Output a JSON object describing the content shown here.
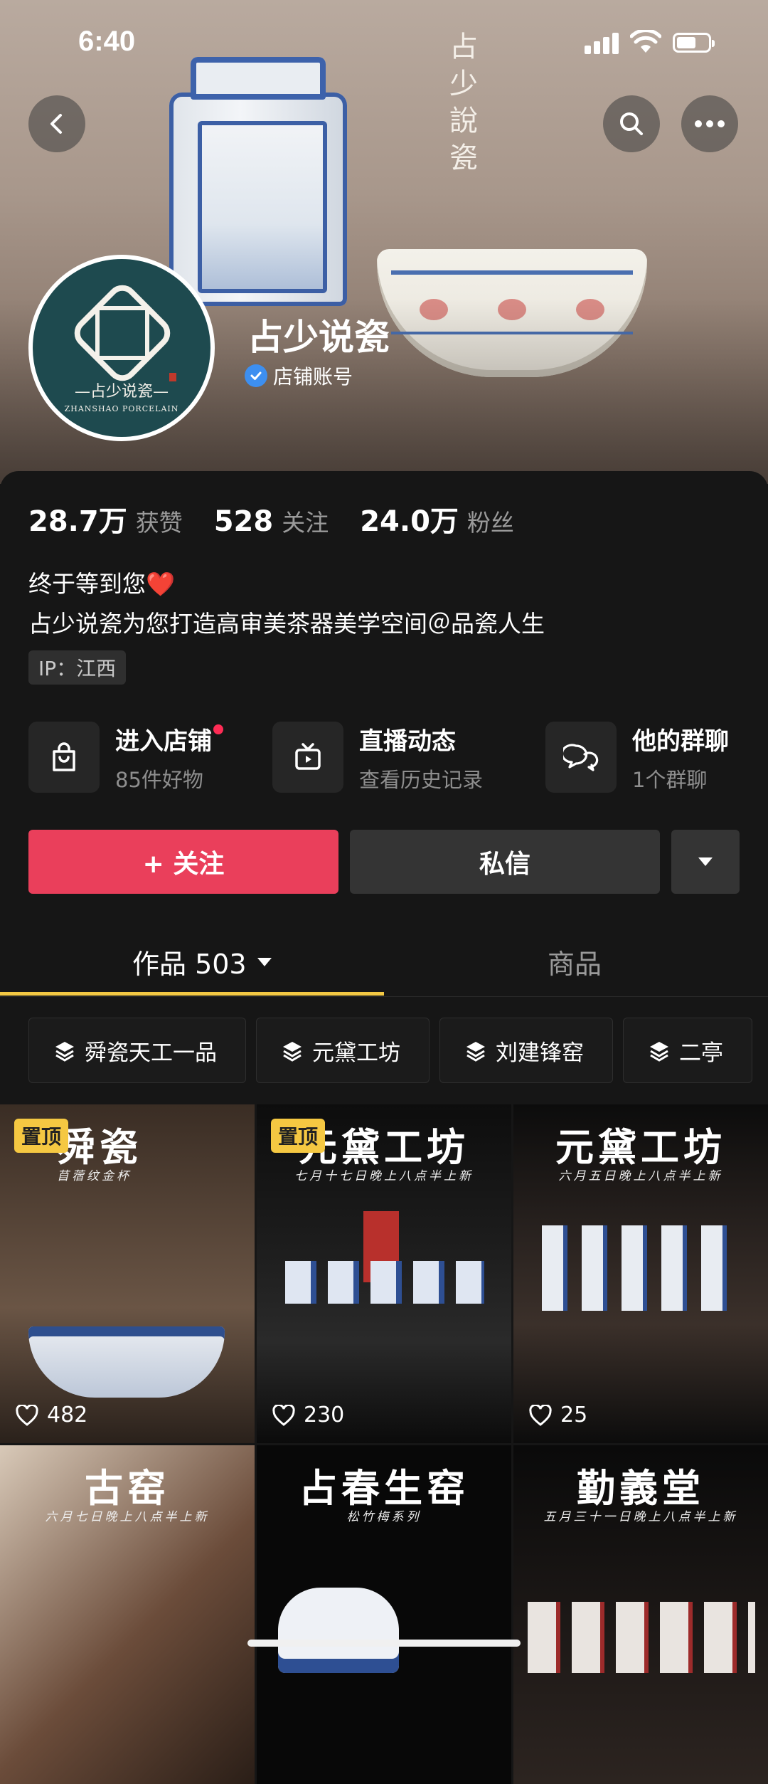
{
  "status_bar": {
    "time": "6:40"
  },
  "header": {
    "cover_vertical_text": "占少說瓷",
    "back_icon": "chevron-left-icon",
    "search_icon": "search-icon",
    "more_icon": "more-dots-icon"
  },
  "profile": {
    "avatar_text_cn": "—占少说瓷—",
    "avatar_text_en": "ZHANSHAO PORCELAIN",
    "name": "占少说瓷",
    "account_type": "店铺账号",
    "verified_color": "#3d8ff0"
  },
  "stats": [
    {
      "value": "28.7万",
      "label": "获赞"
    },
    {
      "value": "528",
      "label": "关注"
    },
    {
      "value": "24.0万",
      "label": "粉丝"
    }
  ],
  "bio": {
    "line1": "终于等到您",
    "line1_emoji": "❤️",
    "line2": "占少说瓷为您打造高审美茶器美学空间＠品瓷人生",
    "ip": "IP：江西"
  },
  "entries": [
    {
      "title": "进入店铺",
      "subtitle": "85件好物",
      "icon": "shopping-bag-icon",
      "has_dot": true
    },
    {
      "title": "直播动态",
      "subtitle": "查看历史记录",
      "icon": "tv-icon",
      "has_dot": false
    },
    {
      "title": "他的群聊",
      "subtitle": "1个群聊",
      "icon": "chat-bubbles-icon",
      "has_dot": false
    }
  ],
  "actions": {
    "follow": "+ 关注",
    "message": "私信",
    "follow_color": "#ea3f5b"
  },
  "tabs": [
    {
      "label": "作品 503",
      "active": true
    },
    {
      "label": "商品",
      "active": false
    }
  ],
  "accent_color": "#f2c844",
  "collections": [
    "舜瓷天工一品",
    "元黛工坊",
    "刘建锋窑",
    "二亭"
  ],
  "videos": [
    {
      "title": "舜瓷",
      "subtitle": "苜蓿纹金杯",
      "pinned": true,
      "pin_label": "置顶",
      "likes": "482"
    },
    {
      "title": "元黛工坊",
      "subtitle": "七月十七日晚上八点半上新",
      "pinned": true,
      "pin_label": "置顶",
      "likes": "230"
    },
    {
      "title": "元黛工坊",
      "subtitle": "六月五日晚上八点半上新",
      "pinned": false,
      "likes": "25"
    },
    {
      "title": "古窑",
      "subtitle": "六月七日晚上八点半上新",
      "pinned": false,
      "likes": ""
    },
    {
      "title": "占春生窑",
      "subtitle": "松竹梅系列",
      "pinned": false,
      "likes": ""
    },
    {
      "title": "勤義堂",
      "subtitle": "五月三十一日晚上八点半上新",
      "pinned": false,
      "likes": ""
    }
  ]
}
